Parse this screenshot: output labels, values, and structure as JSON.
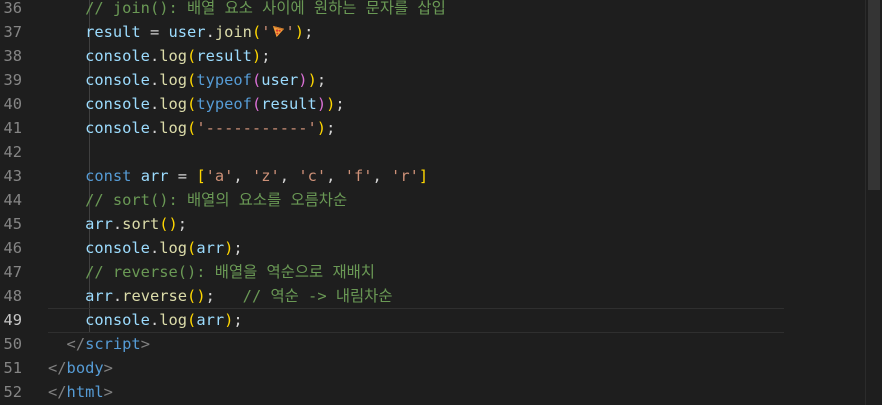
{
  "editor": {
    "current_line": 49,
    "lines": [
      {
        "num": "36",
        "tokens": [
          {
            "t": "    ",
            "c": ""
          },
          {
            "t": "// join(): 배열 요소 사이에 원하는 문자를 삽입",
            "c": "cm"
          }
        ]
      },
      {
        "num": "37",
        "tokens": [
          {
            "t": "    ",
            "c": ""
          },
          {
            "t": "result",
            "c": "vr"
          },
          {
            "t": " = ",
            "c": "op"
          },
          {
            "t": "user",
            "c": "vr"
          },
          {
            "t": ".",
            "c": "op"
          },
          {
            "t": "join",
            "c": "fn"
          },
          {
            "t": "(",
            "c": "b1"
          },
          {
            "t": "'",
            "c": "st"
          },
          {
            "t": "pizza-emoji",
            "c": "emoji"
          },
          {
            "t": "'",
            "c": "st"
          },
          {
            "t": ")",
            "c": "b1"
          },
          {
            "t": ";",
            "c": "op"
          }
        ]
      },
      {
        "num": "38",
        "tokens": [
          {
            "t": "    ",
            "c": ""
          },
          {
            "t": "console",
            "c": "vr"
          },
          {
            "t": ".",
            "c": "op"
          },
          {
            "t": "log",
            "c": "fn"
          },
          {
            "t": "(",
            "c": "b1"
          },
          {
            "t": "result",
            "c": "vr"
          },
          {
            "t": ")",
            "c": "b1"
          },
          {
            "t": ";",
            "c": "op"
          }
        ]
      },
      {
        "num": "39",
        "tokens": [
          {
            "t": "    ",
            "c": ""
          },
          {
            "t": "console",
            "c": "vr"
          },
          {
            "t": ".",
            "c": "op"
          },
          {
            "t": "log",
            "c": "fn"
          },
          {
            "t": "(",
            "c": "b1"
          },
          {
            "t": "typeof",
            "c": "kw"
          },
          {
            "t": "(",
            "c": "b2"
          },
          {
            "t": "user",
            "c": "vr"
          },
          {
            "t": ")",
            "c": "b2"
          },
          {
            "t": ")",
            "c": "b1"
          },
          {
            "t": ";",
            "c": "op"
          }
        ]
      },
      {
        "num": "40",
        "tokens": [
          {
            "t": "    ",
            "c": ""
          },
          {
            "t": "console",
            "c": "vr"
          },
          {
            "t": ".",
            "c": "op"
          },
          {
            "t": "log",
            "c": "fn"
          },
          {
            "t": "(",
            "c": "b1"
          },
          {
            "t": "typeof",
            "c": "kw"
          },
          {
            "t": "(",
            "c": "b2"
          },
          {
            "t": "result",
            "c": "vr"
          },
          {
            "t": ")",
            "c": "b2"
          },
          {
            "t": ")",
            "c": "b1"
          },
          {
            "t": ";",
            "c": "op"
          }
        ]
      },
      {
        "num": "41",
        "tokens": [
          {
            "t": "    ",
            "c": ""
          },
          {
            "t": "console",
            "c": "vr"
          },
          {
            "t": ".",
            "c": "op"
          },
          {
            "t": "log",
            "c": "fn"
          },
          {
            "t": "(",
            "c": "b1"
          },
          {
            "t": "'-----------'",
            "c": "st"
          },
          {
            "t": ")",
            "c": "b1"
          },
          {
            "t": ";",
            "c": "op"
          }
        ]
      },
      {
        "num": "42",
        "tokens": []
      },
      {
        "num": "43",
        "tokens": [
          {
            "t": "    ",
            "c": ""
          },
          {
            "t": "const",
            "c": "kw"
          },
          {
            "t": " ",
            "c": ""
          },
          {
            "t": "arr",
            "c": "vr"
          },
          {
            "t": " = ",
            "c": "op"
          },
          {
            "t": "[",
            "c": "b1"
          },
          {
            "t": "'a'",
            "c": "st"
          },
          {
            "t": ", ",
            "c": "op"
          },
          {
            "t": "'z'",
            "c": "st"
          },
          {
            "t": ", ",
            "c": "op"
          },
          {
            "t": "'c'",
            "c": "st"
          },
          {
            "t": ", ",
            "c": "op"
          },
          {
            "t": "'f'",
            "c": "st"
          },
          {
            "t": ", ",
            "c": "op"
          },
          {
            "t": "'r'",
            "c": "st"
          },
          {
            "t": "]",
            "c": "b1"
          }
        ]
      },
      {
        "num": "44",
        "tokens": [
          {
            "t": "    ",
            "c": ""
          },
          {
            "t": "// sort(): 배열의 요소를 오름차순",
            "c": "cm"
          }
        ]
      },
      {
        "num": "45",
        "tokens": [
          {
            "t": "    ",
            "c": ""
          },
          {
            "t": "arr",
            "c": "vr"
          },
          {
            "t": ".",
            "c": "op"
          },
          {
            "t": "sort",
            "c": "fn"
          },
          {
            "t": "()",
            "c": "b1"
          },
          {
            "t": ";",
            "c": "op"
          }
        ]
      },
      {
        "num": "46",
        "tokens": [
          {
            "t": "    ",
            "c": ""
          },
          {
            "t": "console",
            "c": "vr"
          },
          {
            "t": ".",
            "c": "op"
          },
          {
            "t": "log",
            "c": "fn"
          },
          {
            "t": "(",
            "c": "b1"
          },
          {
            "t": "arr",
            "c": "vr"
          },
          {
            "t": ")",
            "c": "b1"
          },
          {
            "t": ";",
            "c": "op"
          }
        ]
      },
      {
        "num": "47",
        "tokens": [
          {
            "t": "    ",
            "c": ""
          },
          {
            "t": "// reverse(): 배열을 역순으로 재배치",
            "c": "cm"
          }
        ]
      },
      {
        "num": "48",
        "tokens": [
          {
            "t": "    ",
            "c": ""
          },
          {
            "t": "arr",
            "c": "vr"
          },
          {
            "t": ".",
            "c": "op"
          },
          {
            "t": "reverse",
            "c": "fn"
          },
          {
            "t": "()",
            "c": "b1"
          },
          {
            "t": ";   ",
            "c": "op"
          },
          {
            "t": "// 역순 -> 내림차순",
            "c": "cm"
          }
        ]
      },
      {
        "num": "49",
        "tokens": [
          {
            "t": "    ",
            "c": ""
          },
          {
            "t": "console",
            "c": "vr"
          },
          {
            "t": ".",
            "c": "op"
          },
          {
            "t": "log",
            "c": "fn"
          },
          {
            "t": "(",
            "c": "b1"
          },
          {
            "t": "arr",
            "c": "vr"
          },
          {
            "t": ")",
            "c": "b1"
          },
          {
            "t": ";",
            "c": "op"
          }
        ]
      },
      {
        "num": "50",
        "tokens": [
          {
            "t": "  ",
            "c": ""
          },
          {
            "t": "</",
            "c": "tg"
          },
          {
            "t": "script",
            "c": "tn"
          },
          {
            "t": ">",
            "c": "tg"
          }
        ]
      },
      {
        "num": "51",
        "tokens": [
          {
            "t": "</",
            "c": "tg"
          },
          {
            "t": "body",
            "c": "tn"
          },
          {
            "t": ">",
            "c": "tg"
          }
        ]
      },
      {
        "num": "52",
        "tokens": [
          {
            "t": "</",
            "c": "tg"
          },
          {
            "t": "html",
            "c": "tn"
          },
          {
            "t": ">",
            "c": "tg"
          }
        ]
      }
    ]
  },
  "icons": {
    "pizza": "pizza-emoji"
  }
}
